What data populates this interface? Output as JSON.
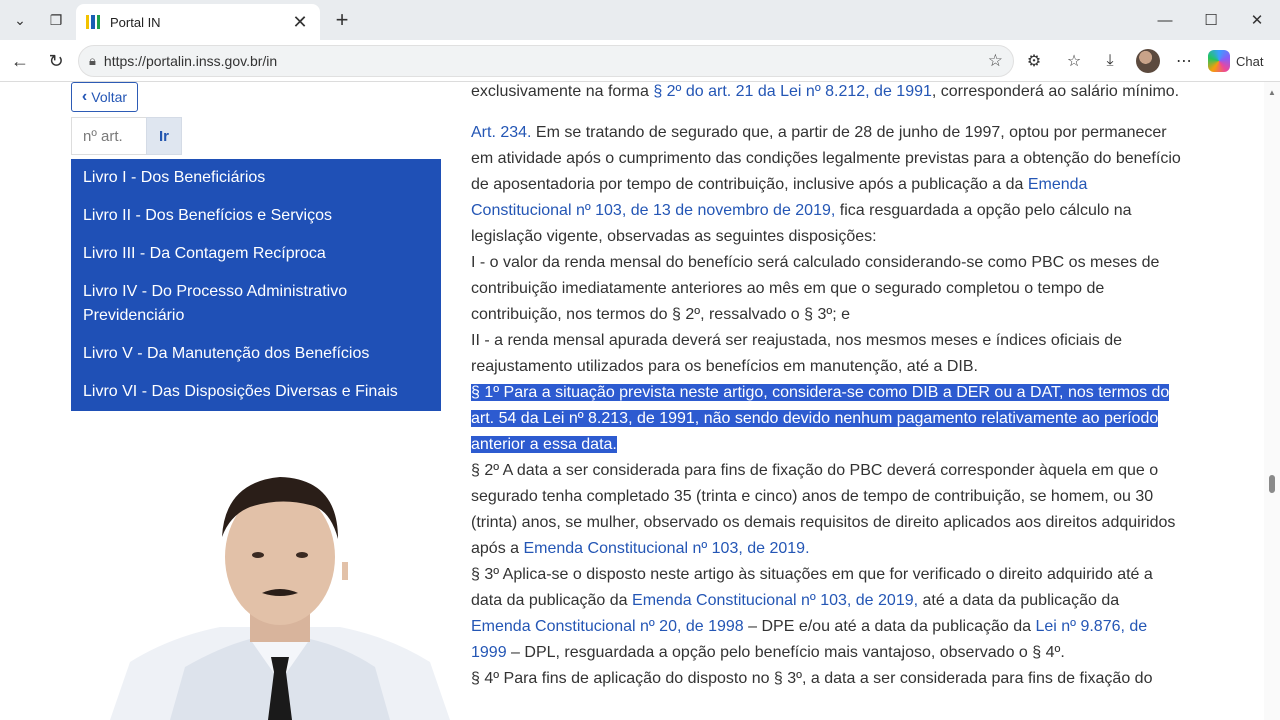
{
  "browser": {
    "tab_title": "Portal IN",
    "url": "https://portalin.inss.gov.br/in",
    "chat_label": "Chat"
  },
  "sidebar": {
    "back_label": "Voltar",
    "article_placeholder": "nº art.",
    "go_label": "Ir",
    "books": [
      "Livro I - Dos Beneficiários",
      "Livro II - Dos Benefícios e Serviços",
      "Livro III - Da Contagem Recíproca",
      "Livro IV - Do Processo Administrativo Previdenciário",
      "Livro V - Da Manutenção dos Benefícios",
      "Livro VI - Das Disposições Diversas e Finais"
    ]
  },
  "article": {
    "p0_a": "exclusivamente na forma ",
    "p0_link": "§ 2º do art. 21 da Lei nº 8.212, de 1991",
    "p0_b": ", corresponderá ao salário mínimo.",
    "art_ref": "Art. 234.",
    "p1_a": " Em se tratando de segurado que, a partir de 28 de junho de 1997, optou por permanecer em atividade após o cumprimento das condições legalmente previstas para a obtenção do benefício de aposentadoria por tempo de contribuição, inclusive após a publicação a da ",
    "p1_link": "Emenda Constitucional nº 103, de 13 de novembro de 2019,",
    "p1_b": " fica resguardada a opção pelo cálculo na legislação vigente, observadas as seguintes disposições:",
    "inc1": "I - o valor da renda mensal do benefício será calculado considerando-se como PBC os meses de contribuição imediatamente anteriores ao mês em que o segurado completou o tempo de contribuição, nos termos do § 2º, ressalvado o § 3º; e",
    "inc2": "II - a renda mensal apurada deverá ser reajustada, nos mesmos meses e índices oficiais de reajustamento utilizados para os benefícios em manutenção, até a DIB.",
    "par1": "§ 1º Para a situação prevista neste artigo, considera-se como DIB a DER ou a DAT, nos termos do art. 54 da Lei nº 8.213, de 1991, não sendo devido nenhum pagamento relativamente ao período anterior a essa data.",
    "par2_a": "§ 2º A data a ser considerada para fins de fixação do PBC deverá corresponder àquela em que o segurado tenha completado 35 (trinta e cinco) anos de tempo de contribuição, se homem, ou 30 (trinta) anos, se mulher, observado os demais requisitos de direito aplicados aos direitos adquiridos após a ",
    "par2_link": "Emenda Constitucional nº 103, de 2019.",
    "par3_a": "§ 3º Aplica-se o disposto neste artigo às situações em que for verificado o direito adquirido até a data da publicação da ",
    "par3_link1": "Emenda Constitucional nº 103, de 2019,",
    "par3_b": " até a data da publicação da ",
    "par3_link2": "Emenda Constitucional nº 20, de 1998",
    "par3_c": " – DPE e/ou até a data da publicação da ",
    "par3_link3": "Lei nº 9.876, de 1999",
    "par3_d": " – DPL, resguardada a opção pelo benefício mais vantajoso, observado o § 4º.",
    "par4": "§ 4º Para fins de aplicação do disposto no § 3º, a data a ser considerada para fins de fixação do"
  }
}
